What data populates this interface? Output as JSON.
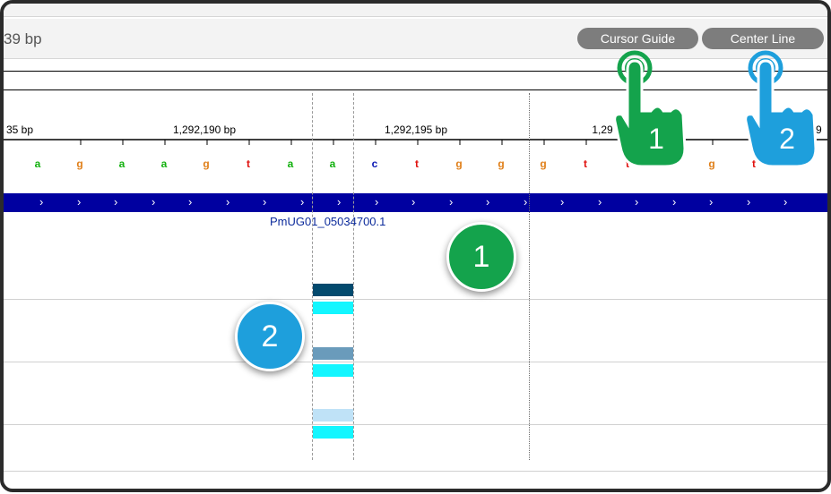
{
  "header": {
    "locus_fragment": "39 bp"
  },
  "buttons": {
    "cursor_guide": "Cursor Guide",
    "center_line": "Center Line"
  },
  "ruler": {
    "labels": [
      "35 bp",
      "1,292,190 bp",
      "1,292,195 bp",
      "1,29",
      "29"
    ]
  },
  "sequence": {
    "bases": [
      "a",
      "g",
      "a",
      "a",
      "g",
      "t",
      "a",
      "a",
      "c",
      "t",
      "g",
      "g",
      "g",
      "t",
      "t",
      "t",
      "g",
      "t"
    ],
    "colors": {
      "a": "#13b10f",
      "g": "#e0801b",
      "t": "#e0120f",
      "c": "#0a17b3"
    }
  },
  "gene": {
    "name": "PmUG01_05034700.1",
    "arrow_glyph": "›"
  },
  "features": {
    "colors": [
      "#034a6e",
      "#13f6ff",
      "#6a9bbb",
      "#13f6ff",
      "#bfe2f7",
      "#13f6ff"
    ]
  },
  "badges": {
    "one": "1",
    "two": "2",
    "hand_one": "1",
    "hand_two": "2",
    "green": "#14a34c",
    "blue": "#1e9fdc"
  }
}
